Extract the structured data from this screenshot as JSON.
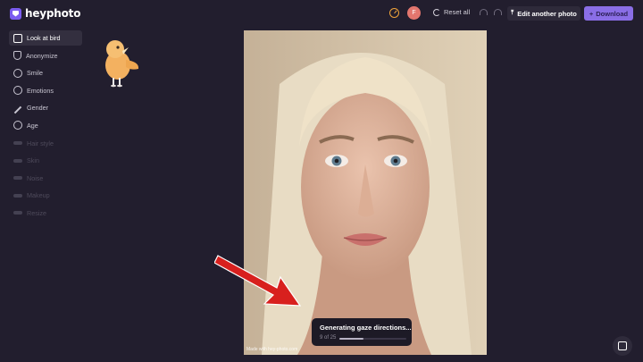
{
  "app": {
    "name": "heyphoto"
  },
  "header": {
    "avatar_initial": "F",
    "reset_label": "Reset all",
    "edit_label": "Edit another photo",
    "download_label": "Download"
  },
  "sidebar": {
    "items": [
      {
        "label": "Look at bird",
        "icon": "bird-frame-icon",
        "state": "active"
      },
      {
        "label": "Anonymize",
        "icon": "shield-icon",
        "state": "enabled"
      },
      {
        "label": "Smile",
        "icon": "smile-icon",
        "state": "enabled"
      },
      {
        "label": "Emotions",
        "icon": "emotion-face-icon",
        "state": "enabled"
      },
      {
        "label": "Gender",
        "icon": "gender-icon",
        "state": "enabled"
      },
      {
        "label": "Age",
        "icon": "age-icon",
        "state": "enabled"
      },
      {
        "label": "Hair style",
        "icon": "hair-icon",
        "state": "disabled"
      },
      {
        "label": "Skin",
        "icon": "skin-icon",
        "state": "disabled"
      },
      {
        "label": "Noise",
        "icon": "noise-icon",
        "state": "disabled"
      },
      {
        "label": "Makeup",
        "icon": "makeup-icon",
        "state": "disabled"
      },
      {
        "label": "Resize",
        "icon": "resize-icon",
        "state": "disabled"
      }
    ]
  },
  "canvas": {
    "watermark": "Made with hey-photo.com",
    "status_title": "Generating gaze directions...",
    "status_count": "9 of 25",
    "progress": 0.36
  },
  "colors": {
    "background": "#221e2e",
    "accent": "#8a6ee6",
    "arrow": "#d8201e",
    "bird": "#f3b160"
  }
}
